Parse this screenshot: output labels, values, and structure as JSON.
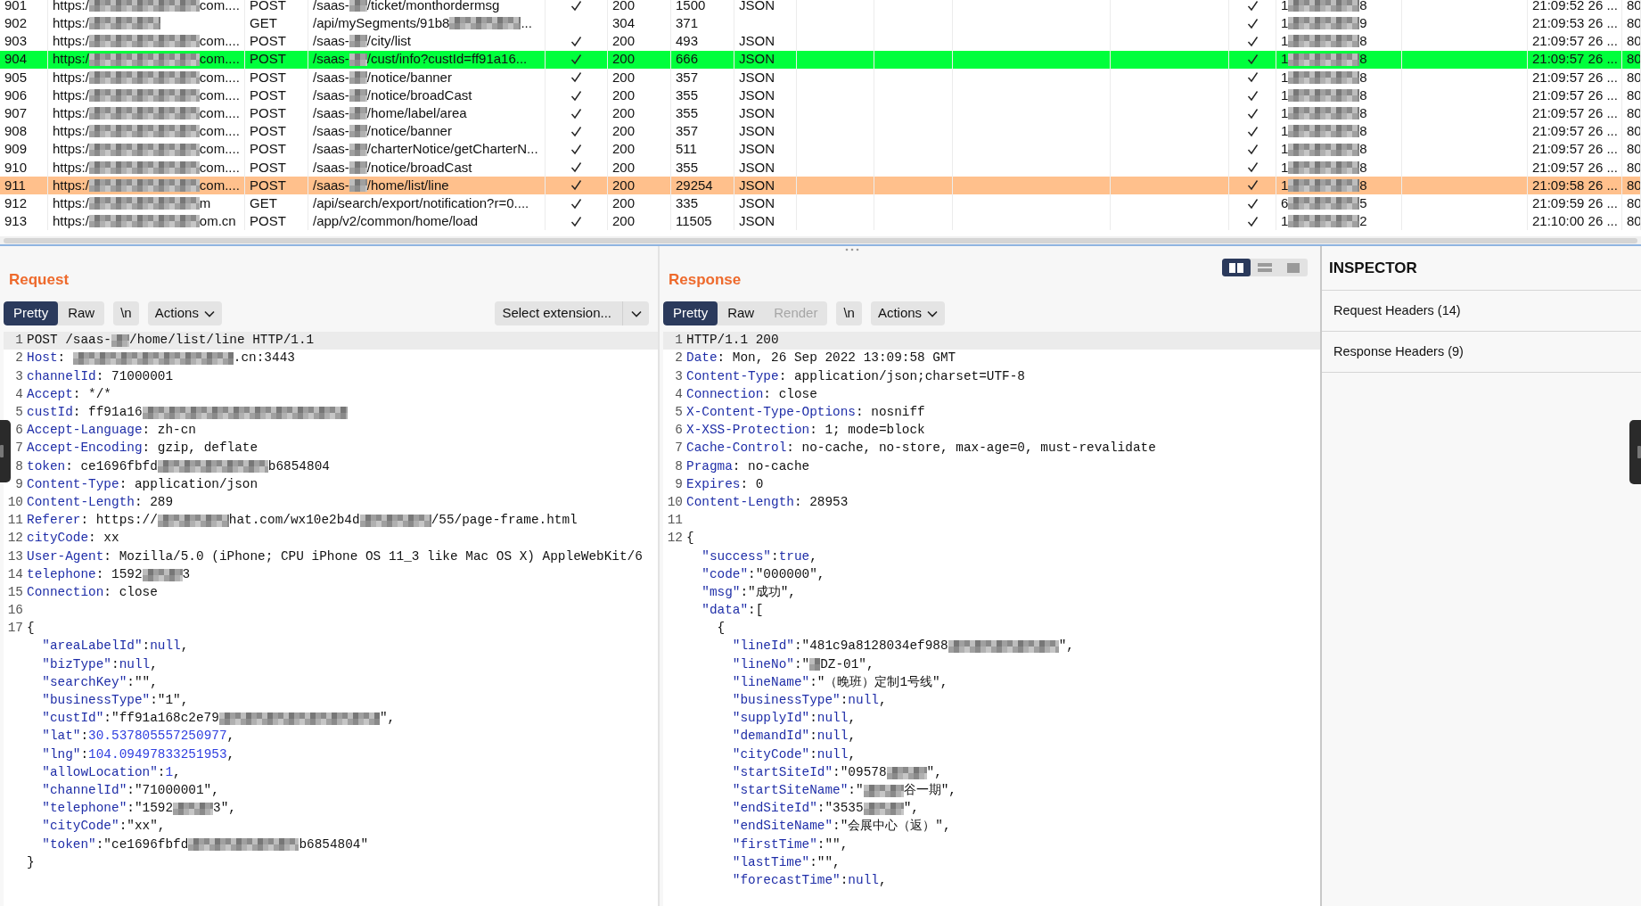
{
  "history": {
    "rows": [
      {
        "num": "901",
        "host": [
          "https:/",
          {
            "kind": "wide"
          },
          "com...."
        ],
        "method": "POST",
        "path": [
          "/saas-",
          {
            "kind": "small"
          },
          "/ticket/monthordermsg"
        ],
        "params": true,
        "status": "200",
        "length": "1500",
        "mime": "JSON",
        "tls": true,
        "ip": [
          "1",
          {
            "kind": "long"
          },
          "8"
        ],
        "time": "21:09:52 26 ...",
        "port": "80"
      },
      {
        "num": "902",
        "host": [
          "https:/",
          {
            "kind": "long"
          }
        ],
        "method": "GET",
        "path": [
          "/api/mySegments/91b8",
          {
            "kind": "long"
          },
          "..."
        ],
        "params": false,
        "status": "304",
        "length": "371",
        "tls": true,
        "ip": [
          "1",
          {
            "kind": "long"
          },
          "9"
        ],
        "time": "21:09:53 26 ...",
        "port": "80"
      },
      {
        "num": "903",
        "host": [
          "https:/",
          {
            "kind": "wide"
          },
          "com...."
        ],
        "method": "POST",
        "path": [
          "/saas-",
          {
            "kind": "small"
          },
          "/city/list"
        ],
        "params": true,
        "status": "200",
        "length": "493",
        "mime": "JSON",
        "tls": true,
        "ip": [
          "1",
          {
            "kind": "long"
          },
          "8"
        ],
        "time": "21:09:57 26 ...",
        "port": "80"
      },
      {
        "num": "904",
        "host": [
          "https:/",
          {
            "kind": "wide"
          },
          "com...."
        ],
        "method": "POST",
        "path": [
          "/saas-",
          {
            "kind": "small"
          },
          "/cust/info?custId=ff91a16..."
        ],
        "params": true,
        "status": "200",
        "length": "666",
        "mime": "JSON",
        "tls": true,
        "ip": [
          "1",
          {
            "kind": "long"
          },
          "8"
        ],
        "time": "21:09:57 26 ...",
        "port": "80",
        "color": "#00ff3c"
      },
      {
        "num": "905",
        "host": [
          "https:/",
          {
            "kind": "wide"
          },
          "com...."
        ],
        "method": "POST",
        "path": [
          "/saas-",
          {
            "kind": "small"
          },
          "/notice/banner"
        ],
        "params": true,
        "status": "200",
        "length": "357",
        "mime": "JSON",
        "tls": true,
        "ip": [
          "1",
          {
            "kind": "long"
          },
          "8"
        ],
        "time": "21:09:57 26 ...",
        "port": "80"
      },
      {
        "num": "906",
        "host": [
          "https:/",
          {
            "kind": "wide"
          },
          "com...."
        ],
        "method": "POST",
        "path": [
          "/saas-",
          {
            "kind": "small"
          },
          "/notice/broadCast"
        ],
        "params": true,
        "status": "200",
        "length": "355",
        "mime": "JSON",
        "tls": true,
        "ip": [
          "1",
          {
            "kind": "long"
          },
          "8"
        ],
        "time": "21:09:57 26 ...",
        "port": "80"
      },
      {
        "num": "907",
        "host": [
          "https:/",
          {
            "kind": "wide"
          },
          "com...."
        ],
        "method": "POST",
        "path": [
          "/saas-",
          {
            "kind": "small"
          },
          "/home/label/area"
        ],
        "params": true,
        "status": "200",
        "length": "355",
        "mime": "JSON",
        "tls": true,
        "ip": [
          "1",
          {
            "kind": "long"
          },
          "8"
        ],
        "time": "21:09:57 26 ...",
        "port": "80"
      },
      {
        "num": "908",
        "host": [
          "https:/",
          {
            "kind": "wide"
          },
          "com...."
        ],
        "method": "POST",
        "path": [
          "/saas-",
          {
            "kind": "small"
          },
          "/notice/banner"
        ],
        "params": true,
        "status": "200",
        "length": "357",
        "mime": "JSON",
        "tls": true,
        "ip": [
          "1",
          {
            "kind": "long"
          },
          "8"
        ],
        "time": "21:09:57 26 ...",
        "port": "80"
      },
      {
        "num": "909",
        "host": [
          "https:/",
          {
            "kind": "wide"
          },
          "com...."
        ],
        "method": "POST",
        "path": [
          "/saas-",
          {
            "kind": "small"
          },
          "/charterNotice/getCharterN..."
        ],
        "params": true,
        "status": "200",
        "length": "511",
        "mime": "JSON",
        "tls": true,
        "ip": [
          "1",
          {
            "kind": "long"
          },
          "8"
        ],
        "time": "21:09:57 26 ...",
        "port": "80"
      },
      {
        "num": "910",
        "host": [
          "https:/",
          {
            "kind": "wide"
          },
          "com...."
        ],
        "method": "POST",
        "path": [
          "/saas-",
          {
            "kind": "small"
          },
          "/notice/broadCast"
        ],
        "params": true,
        "status": "200",
        "length": "355",
        "mime": "JSON",
        "tls": true,
        "ip": [
          "1",
          {
            "kind": "long"
          },
          "8"
        ],
        "time": "21:09:57 26 ...",
        "port": "80"
      },
      {
        "num": "911",
        "host": [
          "https:/",
          {
            "kind": "wide"
          },
          "com...."
        ],
        "method": "POST",
        "path": [
          "/saas-",
          {
            "kind": "small"
          },
          "/home/list/line"
        ],
        "params": true,
        "status": "200",
        "length": "29254",
        "mime": "JSON",
        "tls": true,
        "ip": [
          "1",
          {
            "kind": "long"
          },
          "8"
        ],
        "time": "21:09:58 26 ...",
        "port": "80",
        "color": "#ffc08c"
      },
      {
        "num": "912",
        "host": [
          "https:/",
          {
            "kind": "wide"
          },
          "m"
        ],
        "method": "GET",
        "path": [
          "/api/search/export/notification?r=0...."
        ],
        "params": true,
        "status": "200",
        "length": "335",
        "mime": "JSON",
        "tls": true,
        "ip": [
          "6",
          {
            "kind": "long"
          },
          "5"
        ],
        "time": "21:09:59 26 ...",
        "port": "80"
      },
      {
        "num": "913",
        "host": [
          "https:/",
          {
            "kind": "wide"
          },
          "om.cn"
        ],
        "method": "POST",
        "path": [
          "/app/v2/common/home/load"
        ],
        "params": true,
        "status": "200",
        "length": "11505",
        "mime": "JSON",
        "tls": true,
        "ip": [
          "1",
          {
            "kind": "long"
          },
          "2"
        ],
        "time": "21:10:00 26 ...",
        "port": "80"
      }
    ]
  },
  "request": {
    "title": "Request",
    "tabs": [
      {
        "label": "Pretty",
        "selected": true,
        "disabled": false
      },
      {
        "label": "Raw",
        "selected": false,
        "disabled": false
      }
    ],
    "newline_toggle": "\\n",
    "actions": "Actions",
    "extension": "Select extension...",
    "lines": [
      {
        "n": "1",
        "current": true,
        "parts": [
          {
            "t": "POST /saas-",
            "kind": "text"
          },
          {
            "kind": "small"
          },
          {
            "t": "/home/list/line HTTP/1.1",
            "kind": "text"
          }
        ]
      },
      {
        "n": "2",
        "current": false,
        "parts": [
          {
            "t": "Host",
            "kind": "name"
          },
          {
            "t": ": ",
            "kind": "text"
          },
          {
            "kind": "wider"
          },
          {
            "t": ".cn:3443",
            "kind": "text"
          }
        ]
      },
      {
        "n": "3",
        "current": false,
        "parts": [
          {
            "t": "channelId",
            "kind": "name"
          },
          {
            "t": ": 71000001",
            "kind": "text"
          }
        ]
      },
      {
        "n": "4",
        "current": false,
        "parts": [
          {
            "t": "Accept",
            "kind": "name"
          },
          {
            "t": ": */*",
            "kind": "text"
          }
        ]
      },
      {
        "n": "5",
        "current": false,
        "parts": [
          {
            "t": "custId",
            "kind": "name"
          },
          {
            "t": ": ff91a16",
            "kind": "text"
          },
          {
            "kind": "widest"
          }
        ]
      },
      {
        "n": "6",
        "current": false,
        "parts": [
          {
            "t": "Accept-Language",
            "kind": "name"
          },
          {
            "t": ": zh-cn",
            "kind": "text"
          }
        ]
      },
      {
        "n": "7",
        "current": false,
        "parts": [
          {
            "t": "Accept-Encoding",
            "kind": "name"
          },
          {
            "t": ": gzip, deflate",
            "kind": "text"
          }
        ]
      },
      {
        "n": "8",
        "current": false,
        "parts": [
          {
            "t": "token",
            "kind": "name"
          },
          {
            "t": ": ce1696fbfd",
            "kind": "text"
          },
          {
            "kind": "wide"
          },
          {
            "t": "b6854804",
            "kind": "text"
          }
        ]
      },
      {
        "n": "9",
        "current": false,
        "parts": [
          {
            "t": "Content-Type",
            "kind": "name"
          },
          {
            "t": ": application/json",
            "kind": "text"
          }
        ]
      },
      {
        "n": "10",
        "current": false,
        "parts": [
          {
            "t": "Content-Length",
            "kind": "name"
          },
          {
            "t": ": 289",
            "kind": "text"
          }
        ]
      },
      {
        "n": "11",
        "current": false,
        "parts": [
          {
            "t": "Referer",
            "kind": "name"
          },
          {
            "t": ": https://",
            "kind": "text"
          },
          {
            "kind": "long"
          },
          {
            "t": "hat.com/wx10e2b4d",
            "kind": "text"
          },
          {
            "kind": "long"
          },
          {
            "t": "/55/page-frame.html",
            "kind": "text"
          }
        ]
      },
      {
        "n": "12",
        "current": false,
        "parts": [
          {
            "t": "cityCode",
            "kind": "name"
          },
          {
            "t": ": xx",
            "kind": "text"
          }
        ]
      },
      {
        "n": "13",
        "current": false,
        "parts": [
          {
            "t": "User-Agent",
            "kind": "name"
          },
          {
            "t": ": Mozilla/5.0 (iPhone; CPU iPhone OS 11_3 like Mac OS X) AppleWebKit/6",
            "kind": "text"
          }
        ]
      },
      {
        "n": "14",
        "current": false,
        "parts": [
          {
            "t": "telephone",
            "kind": "name"
          },
          {
            "t": ": 1592",
            "kind": "text"
          },
          {
            "kind": "medium"
          },
          {
            "t": "3",
            "kind": "text"
          }
        ]
      },
      {
        "n": "15",
        "current": false,
        "parts": [
          {
            "t": "Connection",
            "kind": "name"
          },
          {
            "t": ": close",
            "kind": "text"
          }
        ]
      },
      {
        "n": "16",
        "current": false
      },
      {
        "n": "17",
        "current": false,
        "parts": [
          {
            "t": "{",
            "kind": "text"
          }
        ]
      },
      {
        "current": false,
        "parts": [
          {
            "t": "  \"areaLabelId\"",
            "kind": "name"
          },
          {
            "t": ":",
            "kind": "text"
          },
          {
            "t": "null",
            "kind": "name"
          },
          {
            "t": ",",
            "kind": "text"
          }
        ]
      },
      {
        "current": false,
        "parts": [
          {
            "t": "  \"bizType\"",
            "kind": "name"
          },
          {
            "t": ":",
            "kind": "text"
          },
          {
            "t": "null",
            "kind": "name"
          },
          {
            "t": ",",
            "kind": "text"
          }
        ]
      },
      {
        "current": false,
        "parts": [
          {
            "t": "  \"searchKey\"",
            "kind": "name"
          },
          {
            "t": ":\"\",",
            "kind": "text"
          }
        ]
      },
      {
        "current": false,
        "parts": [
          {
            "t": "  \"businessType\"",
            "kind": "name"
          },
          {
            "t": ":\"1\",",
            "kind": "text"
          }
        ]
      },
      {
        "current": false,
        "parts": [
          {
            "t": "  \"custId\"",
            "kind": "name"
          },
          {
            "t": ":\"ff91a168c2e79",
            "kind": "text"
          },
          {
            "kind": "wider"
          },
          {
            "t": "\",",
            "kind": "text"
          }
        ]
      },
      {
        "current": false,
        "parts": [
          {
            "t": "  \"lat\"",
            "kind": "name"
          },
          {
            "t": ":",
            "kind": "text"
          },
          {
            "t": "30.537805557250977",
            "kind": "num"
          },
          {
            "t": ",",
            "kind": "text"
          }
        ]
      },
      {
        "current": false,
        "parts": [
          {
            "t": "  \"lng\"",
            "kind": "name"
          },
          {
            "t": ":",
            "kind": "text"
          },
          {
            "t": "104.09497833251953",
            "kind": "num"
          },
          {
            "t": ",",
            "kind": "text"
          }
        ]
      },
      {
        "current": false,
        "parts": [
          {
            "t": "  \"allowLocation\"",
            "kind": "name"
          },
          {
            "t": ":",
            "kind": "text"
          },
          {
            "t": "1",
            "kind": "num"
          },
          {
            "t": ",",
            "kind": "text"
          }
        ]
      },
      {
        "current": false,
        "parts": [
          {
            "t": "  \"channelId\"",
            "kind": "name"
          },
          {
            "t": ":\"71000001\",",
            "kind": "text"
          }
        ]
      },
      {
        "current": false,
        "parts": [
          {
            "t": "  \"telephone\"",
            "kind": "name"
          },
          {
            "t": ":\"1592",
            "kind": "text"
          },
          {
            "kind": "medium"
          },
          {
            "t": "3\",",
            "kind": "text"
          }
        ]
      },
      {
        "current": false,
        "parts": [
          {
            "t": "  \"cityCode\"",
            "kind": "name"
          },
          {
            "t": ":\"xx\",",
            "kind": "text"
          }
        ]
      },
      {
        "current": false,
        "parts": [
          {
            "t": "  \"token\"",
            "kind": "name"
          },
          {
            "t": ":\"ce1696fbfd",
            "kind": "text"
          },
          {
            "kind": "wide"
          },
          {
            "t": "b6854804\"",
            "kind": "text"
          }
        ]
      },
      {
        "current": false,
        "parts": [
          {
            "t": "}",
            "kind": "text"
          }
        ]
      }
    ]
  },
  "response": {
    "title": "Response",
    "layout_buttons": [
      {
        "selected": true
      },
      {
        "selected": false
      },
      {
        "selected": false
      }
    ],
    "tabs": [
      {
        "label": "Pretty",
        "selected": true,
        "disabled": false
      },
      {
        "label": "Raw",
        "selected": false,
        "disabled": false
      },
      {
        "label": "Render",
        "selected": false,
        "disabled": true
      }
    ],
    "newline_toggle": "\\n",
    "actions": "Actions",
    "lines": [
      {
        "n": "1",
        "current": true,
        "parts": [
          {
            "t": "HTTP/1.1 200",
            "kind": "text"
          }
        ]
      },
      {
        "n": "2",
        "current": false,
        "parts": [
          {
            "t": "Date",
            "kind": "name"
          },
          {
            "t": ": Mon, 26 Sep 2022 13:09:58 GMT",
            "kind": "text"
          }
        ]
      },
      {
        "n": "3",
        "current": false,
        "parts": [
          {
            "t": "Content-Type",
            "kind": "name"
          },
          {
            "t": ": application/json;charset=UTF-8",
            "kind": "text"
          }
        ]
      },
      {
        "n": "4",
        "current": false,
        "parts": [
          {
            "t": "Connection",
            "kind": "name"
          },
          {
            "t": ": close",
            "kind": "text"
          }
        ]
      },
      {
        "n": "5",
        "current": false,
        "parts": [
          {
            "t": "X-Content-Type-Options",
            "kind": "name"
          },
          {
            "t": ": nosniff",
            "kind": "text"
          }
        ]
      },
      {
        "n": "6",
        "current": false,
        "parts": [
          {
            "t": "X-XSS-Protection",
            "kind": "name"
          },
          {
            "t": ": 1; mode=block",
            "kind": "text"
          }
        ]
      },
      {
        "n": "7",
        "current": false,
        "parts": [
          {
            "t": "Cache-Control",
            "kind": "name"
          },
          {
            "t": ": no-cache, no-store, max-age=0, must-revalidate",
            "kind": "text"
          }
        ]
      },
      {
        "n": "8",
        "current": false,
        "parts": [
          {
            "t": "Pragma",
            "kind": "name"
          },
          {
            "t": ": no-cache",
            "kind": "text"
          }
        ]
      },
      {
        "n": "9",
        "current": false,
        "parts": [
          {
            "t": "Expires",
            "kind": "name"
          },
          {
            "t": ": 0",
            "kind": "text"
          }
        ]
      },
      {
        "n": "10",
        "current": false,
        "parts": [
          {
            "t": "Content-Length",
            "kind": "name"
          },
          {
            "t": ": 28953",
            "kind": "text"
          }
        ]
      },
      {
        "n": "11",
        "current": false
      },
      {
        "n": "12",
        "current": false,
        "parts": [
          {
            "t": "{",
            "kind": "text"
          }
        ]
      },
      {
        "current": false,
        "parts": [
          {
            "t": "  \"success\"",
            "kind": "name"
          },
          {
            "t": ":",
            "kind": "text"
          },
          {
            "t": "true",
            "kind": "name"
          },
          {
            "t": ",",
            "kind": "text"
          }
        ]
      },
      {
        "current": false,
        "parts": [
          {
            "t": "  \"code\"",
            "kind": "name"
          },
          {
            "t": ":\"000000\",",
            "kind": "text"
          }
        ]
      },
      {
        "current": false,
        "parts": [
          {
            "t": "  \"msg\"",
            "kind": "name"
          },
          {
            "t": ":\"成功\",",
            "kind": "text"
          }
        ]
      },
      {
        "current": false,
        "parts": [
          {
            "t": "  \"data\"",
            "kind": "name"
          },
          {
            "t": ":[",
            "kind": "text"
          }
        ]
      },
      {
        "current": false,
        "parts": [
          {
            "t": "    {",
            "kind": "text"
          }
        ]
      },
      {
        "current": false,
        "parts": [
          {
            "t": "      \"lineId\"",
            "kind": "name"
          },
          {
            "t": ":\"481c9a8128034ef988",
            "kind": "text"
          },
          {
            "kind": "wide"
          },
          {
            "t": "\",",
            "kind": "text"
          }
        ]
      },
      {
        "current": false,
        "parts": [
          {
            "t": "      \"lineNo\"",
            "kind": "name"
          },
          {
            "t": ":\"",
            "kind": "text"
          },
          {
            "kind": "tiny"
          },
          {
            "t": "DZ-01\",",
            "kind": "text"
          }
        ]
      },
      {
        "current": false,
        "parts": [
          {
            "t": "      \"lineName\"",
            "kind": "name"
          },
          {
            "t": ":\"（晚班）定制1号线\",",
            "kind": "text"
          }
        ]
      },
      {
        "current": false,
        "parts": [
          {
            "t": "      \"businessType\"",
            "kind": "name"
          },
          {
            "t": ":",
            "kind": "text"
          },
          {
            "t": "null",
            "kind": "name"
          },
          {
            "t": ",",
            "kind": "text"
          }
        ]
      },
      {
        "current": false,
        "parts": [
          {
            "t": "      \"supplyId\"",
            "kind": "name"
          },
          {
            "t": ":",
            "kind": "text"
          },
          {
            "t": "null",
            "kind": "name"
          },
          {
            "t": ",",
            "kind": "text"
          }
        ]
      },
      {
        "current": false,
        "parts": [
          {
            "t": "      \"demandId\"",
            "kind": "name"
          },
          {
            "t": ":",
            "kind": "text"
          },
          {
            "t": "null",
            "kind": "name"
          },
          {
            "t": ",",
            "kind": "text"
          }
        ]
      },
      {
        "current": false,
        "parts": [
          {
            "t": "      \"cityCode\"",
            "kind": "name"
          },
          {
            "t": ":",
            "kind": "text"
          },
          {
            "t": "null",
            "kind": "name"
          },
          {
            "t": ",",
            "kind": "text"
          }
        ]
      },
      {
        "current": false,
        "parts": [
          {
            "t": "      \"startSiteId\"",
            "kind": "name"
          },
          {
            "t": ":\"09578",
            "kind": "text"
          },
          {
            "kind": "medium"
          },
          {
            "t": "\",",
            "kind": "text"
          }
        ]
      },
      {
        "current": false,
        "parts": [
          {
            "t": "      \"startSiteName\"",
            "kind": "name"
          },
          {
            "t": ":\"",
            "kind": "text"
          },
          {
            "kind": "medium"
          },
          {
            "t": "谷一期\",",
            "kind": "text"
          }
        ]
      },
      {
        "current": false,
        "parts": [
          {
            "t": "      \"endSiteId\"",
            "kind": "name"
          },
          {
            "t": ":\"3535",
            "kind": "text"
          },
          {
            "kind": "medium"
          },
          {
            "t": "\",",
            "kind": "text"
          }
        ]
      },
      {
        "current": false,
        "parts": [
          {
            "t": "      \"endSiteName\"",
            "kind": "name"
          },
          {
            "t": ":\"会展中心（返）\",",
            "kind": "text"
          }
        ]
      },
      {
        "current": false,
        "parts": [
          {
            "t": "      \"firstTime\"",
            "kind": "name"
          },
          {
            "t": ":\"\",",
            "kind": "text"
          }
        ]
      },
      {
        "current": false,
        "parts": [
          {
            "t": "      \"lastTime\"",
            "kind": "name"
          },
          {
            "t": ":\"\",",
            "kind": "text"
          }
        ]
      },
      {
        "current": false,
        "parts": [
          {
            "t": "      \"forecastTime\"",
            "kind": "name"
          },
          {
            "t": ":",
            "kind": "text"
          },
          {
            "t": "null",
            "kind": "name"
          },
          {
            "t": ",",
            "kind": "text"
          }
        ]
      }
    ]
  },
  "inspector": {
    "title": "INSPECTOR",
    "sections": [
      "Request Headers (14)",
      "Response Headers (9)"
    ]
  }
}
